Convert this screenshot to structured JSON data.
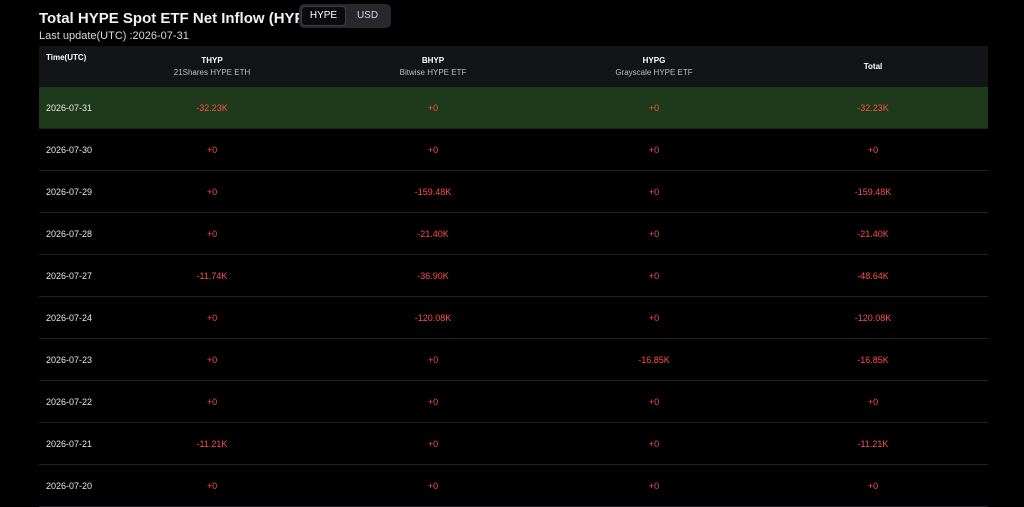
{
  "page": {
    "title": "Total HYPE Spot ETF Net Inflow (HYPE)",
    "last_update": "Last update(UTC) :2026-07-31"
  },
  "toggle": {
    "options": [
      "HYPE",
      "USD"
    ],
    "selected": "HYPE"
  },
  "table": {
    "columns": [
      {
        "code": "Time(UTC)",
        "sub": ""
      },
      {
        "code": "THYP",
        "sub": "21Shares HYPE ETH"
      },
      {
        "code": "BHYP",
        "sub": "Bitwise HYPE ETF"
      },
      {
        "code": "HYPG",
        "sub": "Grayscale HYPE ETF"
      },
      {
        "code": "Total",
        "sub": ""
      }
    ],
    "rows": [
      {
        "date": "2026-07-31",
        "thyp": "-32.23K",
        "bhyp": "+0",
        "hypg": "+0",
        "total": "-32.23K"
      },
      {
        "date": "2026-07-30",
        "thyp": "+0",
        "bhyp": "+0",
        "hypg": "+0",
        "total": "+0"
      },
      {
        "date": "2026-07-29",
        "thyp": "+0",
        "bhyp": "-159.48K",
        "hypg": "+0",
        "total": "-159.48K"
      },
      {
        "date": "2026-07-28",
        "thyp": "+0",
        "bhyp": "-21.40K",
        "hypg": "+0",
        "total": "-21.40K"
      },
      {
        "date": "2026-07-27",
        "thyp": "-11.74K",
        "bhyp": "-36.90K",
        "hypg": "+0",
        "total": "-48.64K"
      },
      {
        "date": "2026-07-24",
        "thyp": "+0",
        "bhyp": "-120.08K",
        "hypg": "+0",
        "total": "-120.08K"
      },
      {
        "date": "2026-07-23",
        "thyp": "+0",
        "bhyp": "+0",
        "hypg": "-16.85K",
        "total": "-16.85K"
      },
      {
        "date": "2026-07-22",
        "thyp": "+0",
        "bhyp": "+0",
        "hypg": "+0",
        "total": "+0"
      },
      {
        "date": "2026-07-21",
        "thyp": "-11.21K",
        "bhyp": "+0",
        "hypg": "+0",
        "total": "-11.21K"
      },
      {
        "date": "2026-07-20",
        "thyp": "+0",
        "bhyp": "+0",
        "hypg": "+0",
        "total": "+0"
      }
    ]
  },
  "colors": {
    "background": "#000000",
    "header_row": "#121417",
    "highlight_row": "#1e3a1b",
    "value_text": "#ff4d4d",
    "row_divider": "#1f2226"
  }
}
